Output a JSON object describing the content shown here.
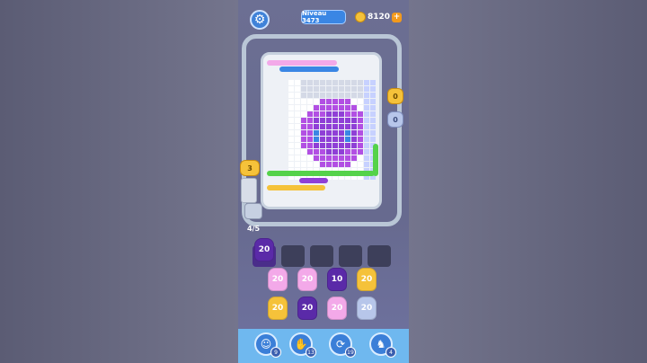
{
  "header": {
    "settings_icon": "gear-icon",
    "level_label": "Niveau 3473",
    "coin_count": "8120",
    "coin_plus": "+"
  },
  "board": {
    "side_counter": "3",
    "right_char_counts": [
      "0",
      "0"
    ],
    "progress": "4/5"
  },
  "slots": {
    "filled_count": "20"
  },
  "queue": {
    "rows": [
      [
        {
          "label": "20",
          "color": "#f3a9e9"
        },
        {
          "label": "20",
          "color": "#f3a9e9"
        },
        {
          "label": "10",
          "color": "#5a2aa8"
        },
        {
          "label": "20",
          "color": "#f5c23a"
        }
      ],
      [
        {
          "label": "20",
          "color": "#f5c23a"
        },
        {
          "label": "20",
          "color": "#5a2aa8"
        },
        {
          "label": "20",
          "color": "#f3a9e9"
        },
        {
          "label": "20",
          "color": "#b7c6ea"
        }
      ]
    ]
  },
  "toolbar": {
    "tools": [
      {
        "icon": "character-icon",
        "badge": "9"
      },
      {
        "icon": "hand-icon",
        "badge": "13"
      },
      {
        "icon": "refresh-icon",
        "badge": "19"
      },
      {
        "icon": "rabbit-icon",
        "badge": "4"
      }
    ]
  },
  "colors": {
    "purple": "#8f3fd6",
    "pink": "#f3a9e9",
    "yellow": "#f5c23a",
    "blue": "#3a86e4",
    "green": "#55d24a"
  }
}
